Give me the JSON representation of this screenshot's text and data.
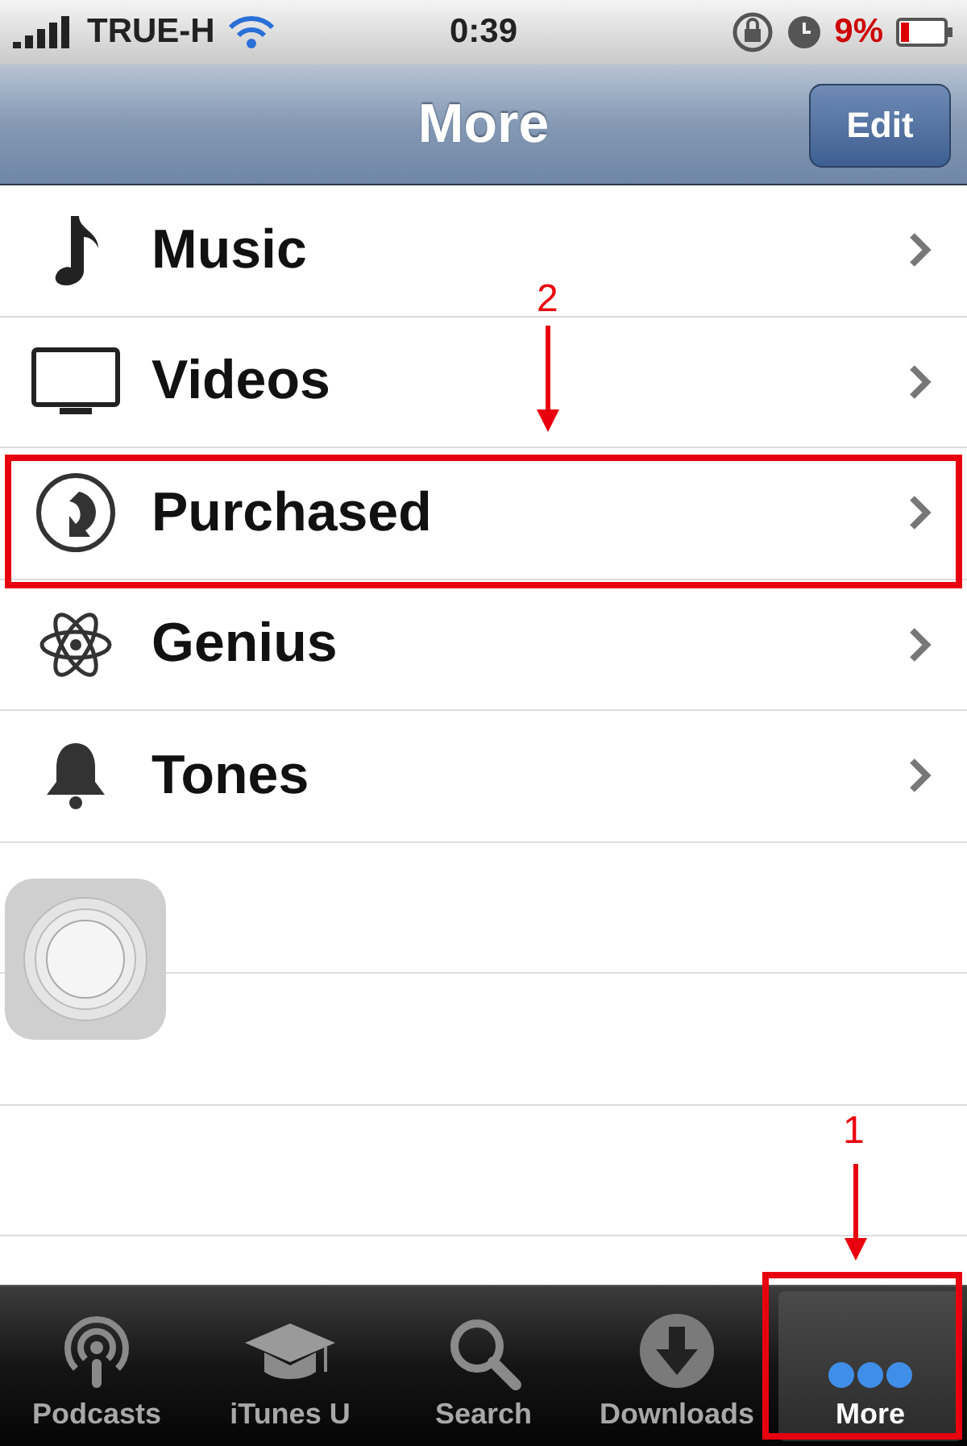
{
  "status_bar": {
    "carrier": "TRUE-H",
    "time": "0:39",
    "battery": "9%"
  },
  "nav_bar": {
    "title": "More",
    "button": "Edit"
  },
  "rows": [
    {
      "label": "Music"
    },
    {
      "label": "Videos"
    },
    {
      "label": "Purchased"
    },
    {
      "label": "Genius"
    },
    {
      "label": "Tones"
    }
  ],
  "tabs": [
    {
      "label": "Podcasts",
      "selected": false
    },
    {
      "label": "iTunes U",
      "selected": false
    },
    {
      "label": "Search",
      "selected": false
    },
    {
      "label": "Downloads",
      "selected": false
    },
    {
      "label": "More",
      "selected": true
    }
  ],
  "annotations": [
    {
      "number": "2",
      "kind": "row"
    },
    {
      "number": "1",
      "kind": "tab"
    }
  ]
}
